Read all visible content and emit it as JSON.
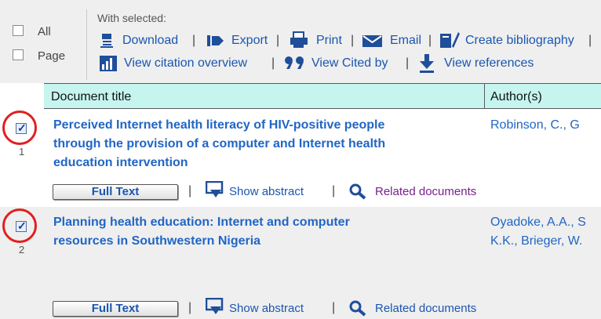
{
  "selection": {
    "all_label": "All",
    "page_label": "Page"
  },
  "toolbar": {
    "with_selected": "With selected:",
    "download": "Download",
    "export": "Export",
    "print": "Print",
    "email": "Email",
    "create_bibliography": "Create bibliography",
    "view_citation_overview": "View citation overview",
    "view_cited_by": "View Cited by",
    "view_references": "View references",
    "separator": "|"
  },
  "table": {
    "headers": [
      "Document title",
      "Author(s)"
    ],
    "rows": [
      {
        "number": "1",
        "checked": true,
        "title_lines": [
          "Perceived Internet health literacy of HIV-positive people",
          "through the provision of a computer and Internet health",
          "education intervention"
        ],
        "author_lines": [
          "Robinson, C., G"
        ],
        "full_text": "Full Text",
        "show_abstract": "Show abstract",
        "related_documents": "Related documents"
      },
      {
        "number": "2",
        "checked": true,
        "title_lines": [
          "Planning health education: Internet and computer",
          "resources in Southwestern Nigeria"
        ],
        "author_lines": [
          "Oyadoke, A.A., S",
          "K.K., Brieger, W."
        ],
        "full_text": "Full Text",
        "show_abstract": "Show abstract",
        "related_documents": "Related documents"
      }
    ]
  },
  "colors": {
    "link": "#1a56b0",
    "title_link": "#2166c5",
    "visited_link": "#7a1f8e",
    "header_bg": "#c5f5ee",
    "annotation_circle": "#e0201f",
    "toolbar_bg": "#efefef"
  },
  "icons": [
    "download-icon",
    "export-icon",
    "print-icon",
    "email-icon",
    "bibliography-icon",
    "citation-overview-icon",
    "cited-by-icon",
    "references-icon",
    "show-abstract-icon",
    "magnifier-icon"
  ]
}
